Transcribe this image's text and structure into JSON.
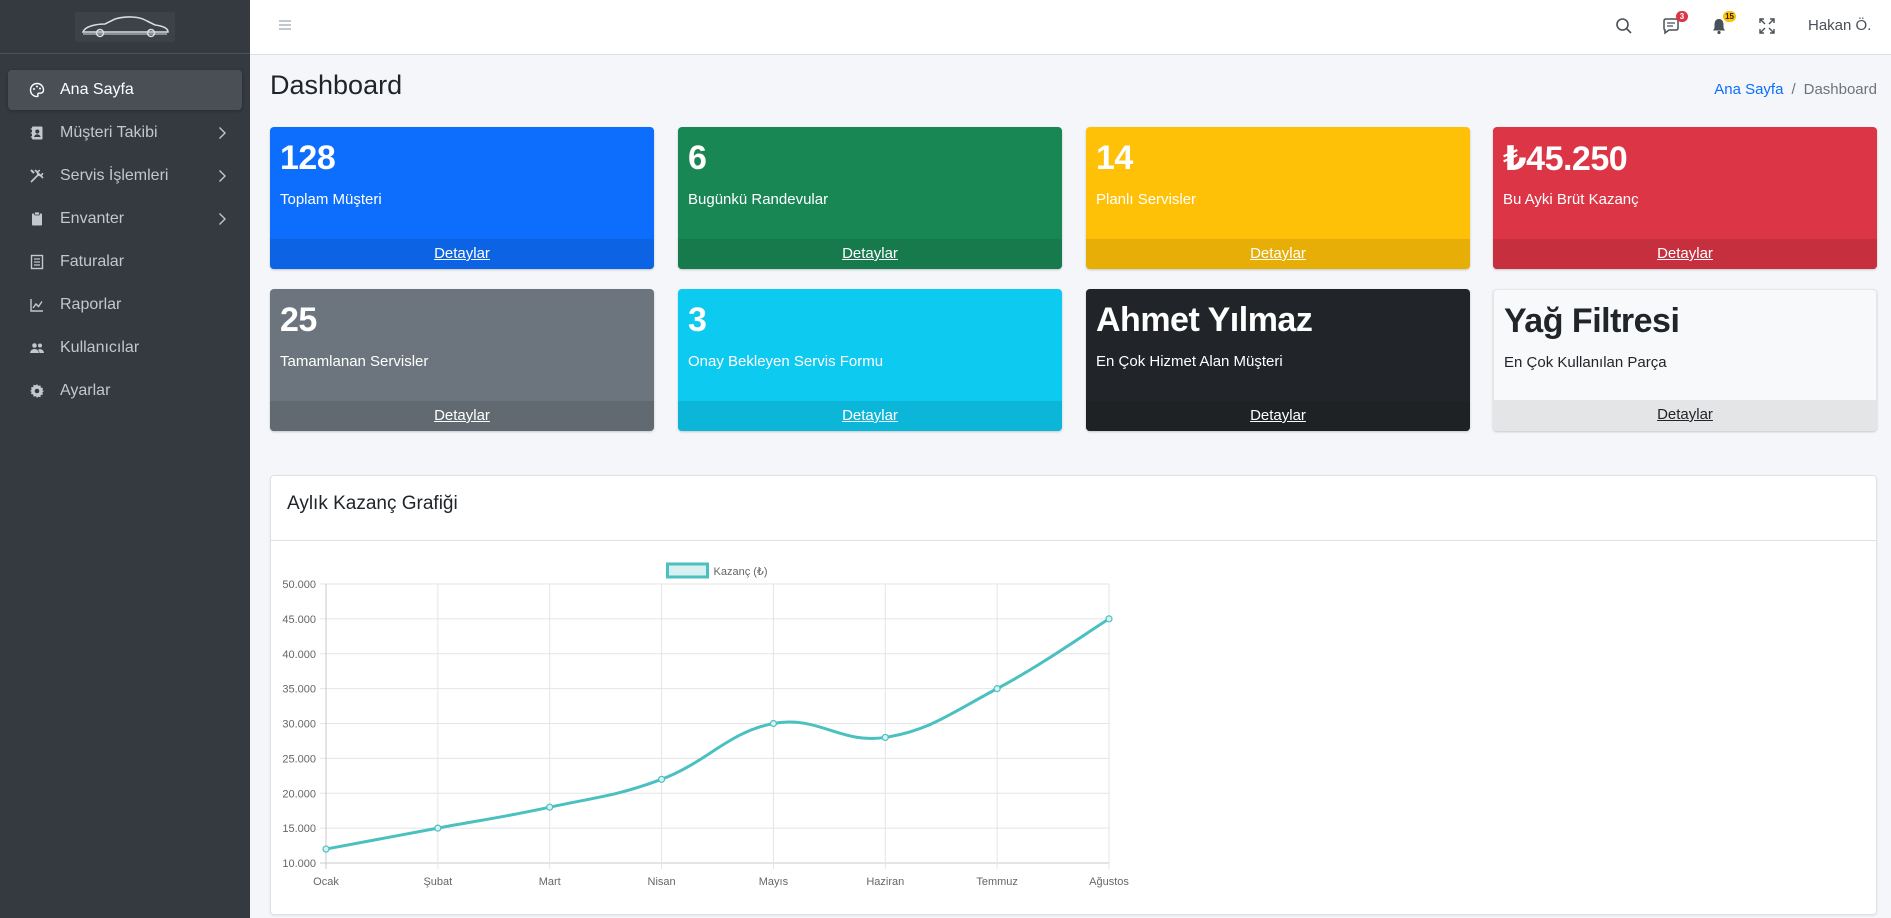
{
  "sidebar": {
    "items": [
      {
        "label": "Ana Sayfa",
        "icon": "palette-icon",
        "active": true,
        "has_children": false
      },
      {
        "label": "Müşteri Takibi",
        "icon": "contact-book-icon",
        "active": false,
        "has_children": true
      },
      {
        "label": "Servis İşlemleri",
        "icon": "tools-icon",
        "active": false,
        "has_children": true
      },
      {
        "label": "Envanter",
        "icon": "clipboard-icon",
        "active": false,
        "has_children": true
      },
      {
        "label": "Faturalar",
        "icon": "invoice-icon",
        "active": false,
        "has_children": false
      },
      {
        "label": "Raporlar",
        "icon": "chart-line-icon",
        "active": false,
        "has_children": false
      },
      {
        "label": "Kullanıcılar",
        "icon": "users-icon",
        "active": false,
        "has_children": false
      },
      {
        "label": "Ayarlar",
        "icon": "gear-icon",
        "active": false,
        "has_children": false
      }
    ]
  },
  "topbar": {
    "messages_badge": "3",
    "notifications_badge": "15",
    "user_name": "Hakan Ö."
  },
  "page": {
    "title": "Dashboard",
    "breadcrumb": {
      "home": "Ana Sayfa",
      "separator": "/",
      "current": "Dashboard"
    }
  },
  "stats": [
    {
      "value": "128",
      "label": "Toplam Müşteri",
      "footer": "Detaylar",
      "color": "#0d6efd"
    },
    {
      "value": "6",
      "label": "Bugünkü Randevular",
      "footer": "Detaylar",
      "color": "#198754"
    },
    {
      "value": "14",
      "label": "Planlı Servisler",
      "footer": "Detaylar",
      "color": "#ffc107"
    },
    {
      "value": "₺45.250",
      "label": "Bu Ayki Brüt Kazanç",
      "footer": "Detaylar",
      "color": "#dc3545"
    },
    {
      "value": "25",
      "label": "Tamamlanan Servisler",
      "footer": "Detaylar",
      "color": "#6c757d"
    },
    {
      "value": "3",
      "label": "Onay Bekleyen Servis Formu",
      "footer": "Detaylar",
      "color": "#0dcaf0"
    },
    {
      "value": "Ahmet Yılmaz",
      "label": "En Çok Hizmet Alan Müşteri",
      "footer": "Detaylar",
      "color": "#212529"
    },
    {
      "value": "Yağ Filtresi",
      "label": "En Çok Kullanılan Parça",
      "footer": "Detaylar",
      "color": "#f8f9fa"
    }
  ],
  "chart_card": {
    "title": "Aylık Kazanç Grafiği"
  },
  "chart_data": {
    "type": "line",
    "title": "",
    "xlabel": "",
    "ylabel": "",
    "categories": [
      "Ocak",
      "Şubat",
      "Mart",
      "Nisan",
      "Mayıs",
      "Haziran",
      "Temmuz",
      "Ağustos"
    ],
    "series": [
      {
        "name": "Kazanç (₺)",
        "values": [
          12000,
          15000,
          18000,
          22000,
          30000,
          28000,
          35000,
          45000
        ],
        "color": "#4bc0c0"
      }
    ],
    "ylim": [
      10000,
      50000
    ],
    "yticks": [
      "10.000",
      "15.000",
      "20.000",
      "25.000",
      "30.000",
      "35.000",
      "40.000",
      "45.000",
      "50.000"
    ],
    "legend": "top",
    "grid": true
  }
}
